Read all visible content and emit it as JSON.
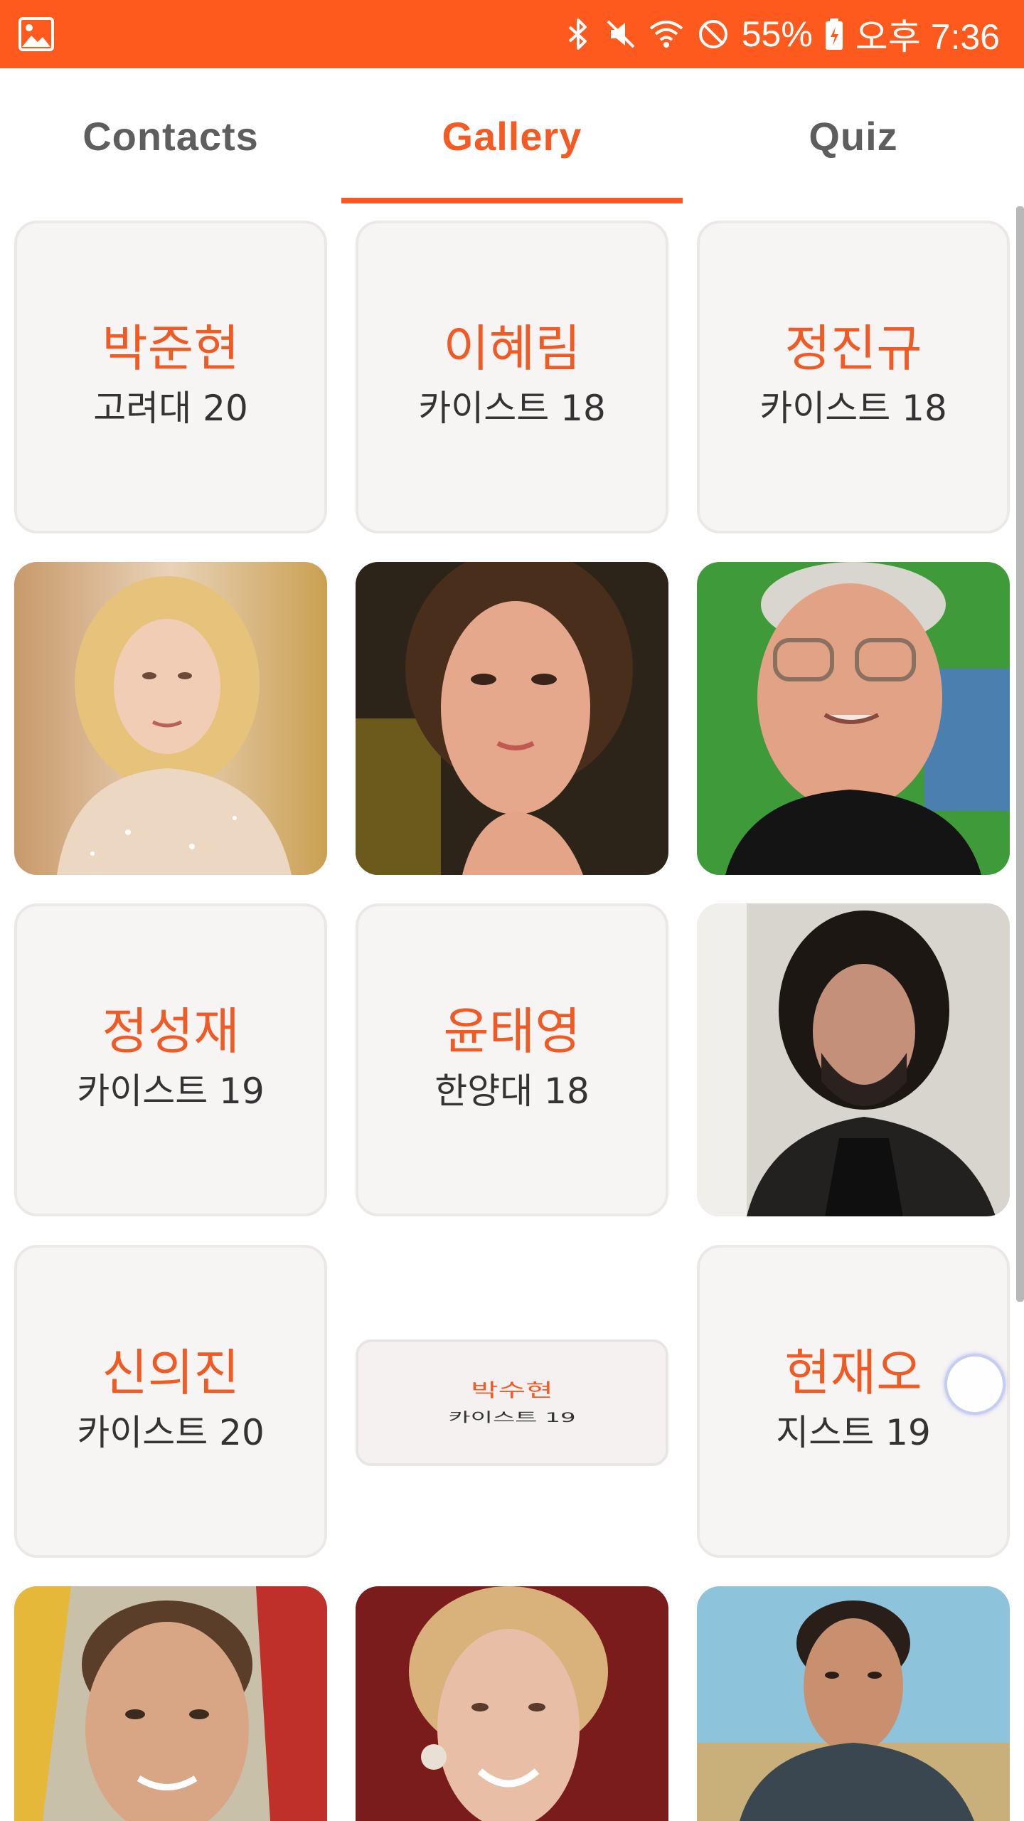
{
  "status_bar": {
    "battery": "55%",
    "time": "오후 7:36",
    "background": "#fe5a1d",
    "icons": [
      "gallery-notification-icon",
      "bluetooth-icon",
      "mute-icon",
      "wifi-icon",
      "no-disturb-icon",
      "battery-charging-icon"
    ]
  },
  "tabs": [
    {
      "label": "Contacts",
      "active": false
    },
    {
      "label": "Gallery",
      "active": true
    },
    {
      "label": "Quiz",
      "active": false
    }
  ],
  "accent_color": "#f45a22",
  "cards": [
    {
      "type": "text",
      "name": "박준현",
      "school": "고려대 20"
    },
    {
      "type": "text",
      "name": "이혜림",
      "school": "카이스트 18"
    },
    {
      "type": "text",
      "name": "정진규",
      "school": "카이스트 18"
    },
    {
      "type": "photo",
      "subject": "woman-blonde-wavy-hair"
    },
    {
      "type": "photo",
      "subject": "woman-brown-hair-updo"
    },
    {
      "type": "photo",
      "subject": "older-man-glasses"
    },
    {
      "type": "text",
      "name": "정성재",
      "school": "카이스트 19"
    },
    {
      "type": "text",
      "name": "윤태영",
      "school": "한양대 18"
    },
    {
      "type": "photo",
      "subject": "man-long-hair-beard"
    },
    {
      "type": "text",
      "name": "신의진",
      "school": "카이스트 20"
    },
    {
      "type": "flipping",
      "name": "박수현",
      "school": "카이스트 19"
    },
    {
      "type": "text",
      "name": "현재오",
      "school": "지스트 19"
    },
    {
      "type": "photo",
      "subject": "man-smiling-stubble"
    },
    {
      "type": "photo",
      "subject": "woman-blonde-smiling"
    },
    {
      "type": "photo",
      "subject": "man-dark-suit"
    }
  ]
}
